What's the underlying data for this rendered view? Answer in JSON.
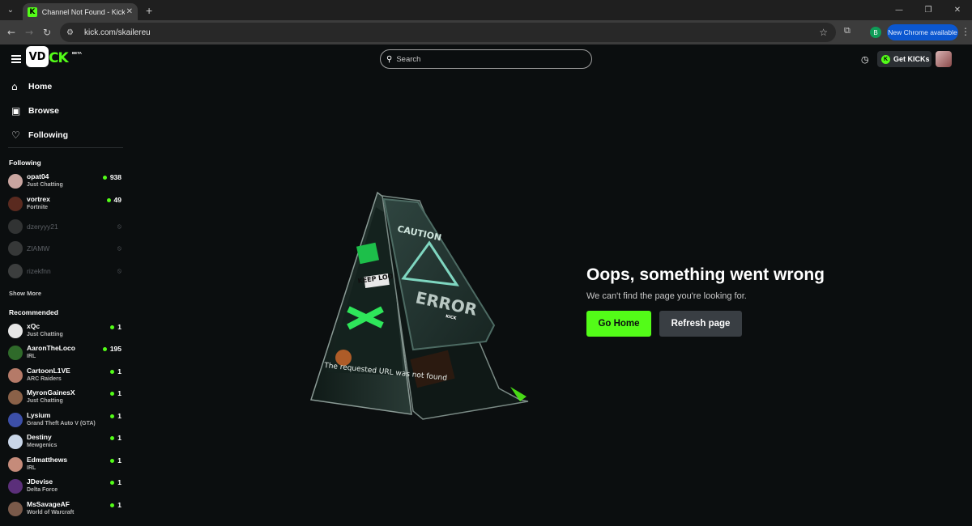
{
  "browser": {
    "tab_title": "Channel Not Found - Kick Strea",
    "url": "kick.com/skailereu",
    "update_label": "New Chrome available",
    "profile_initial": "B"
  },
  "header": {
    "logo_badge": "VD",
    "logo_text": "CK",
    "logo_beta": "BETA",
    "search_placeholder": "Search",
    "get_kicks_label": "Get KICKs",
    "get_kicks_icon": "K"
  },
  "sidebar": {
    "nav": [
      {
        "label": "Home",
        "icon": "home-icon"
      },
      {
        "label": "Browse",
        "icon": "browse-icon"
      },
      {
        "label": "Following",
        "icon": "heart-icon"
      }
    ],
    "following_title": "Following",
    "following": [
      {
        "name": "opat04",
        "category": "Just Chatting",
        "viewers": "938",
        "live": true
      },
      {
        "name": "vortrex",
        "category": "Fortnite",
        "viewers": "49",
        "live": true
      },
      {
        "name": "dzeryyy21",
        "live": false
      },
      {
        "name": "ZIAMW",
        "live": false
      },
      {
        "name": "rizekfnn",
        "live": false
      }
    ],
    "show_more": "Show More",
    "recommended_title": "Recommended",
    "recommended": [
      {
        "name": "xQc",
        "category": "Just Chatting",
        "viewers": "1"
      },
      {
        "name": "AaronTheLoco",
        "category": "IRL",
        "viewers": "195"
      },
      {
        "name": "CartoonL1VE",
        "category": "ARC Raiders",
        "viewers": "1"
      },
      {
        "name": "MyronGainesX",
        "category": "Just Chatting",
        "viewers": "1"
      },
      {
        "name": "Lysium",
        "category": "Grand Theft Auto V (GTA)",
        "viewers": "1"
      },
      {
        "name": "Destiny",
        "category": "Mewgenics",
        "viewers": "1"
      },
      {
        "name": "Edmatthews",
        "category": "IRL",
        "viewers": "1"
      },
      {
        "name": "JDevise",
        "category": "Delta Force",
        "viewers": "1"
      },
      {
        "name": "MsSavageAF",
        "category": "World of Warcraft",
        "viewers": "1"
      }
    ]
  },
  "main": {
    "title": "Oops, something went wrong",
    "subtitle": "We can't find the page you're looking for.",
    "home_button": "Go Home",
    "refresh_button": "Refresh page",
    "sign": {
      "top_text": "CAUTION",
      "error_text": "ERROR",
      "brand": "KICK",
      "side_text": "KEEP LOOKI",
      "message": "The requested URL was not found"
    }
  },
  "colors": {
    "accent": "#53fc18",
    "background": "#0b0e0f",
    "secondary_button": "#393e43"
  }
}
